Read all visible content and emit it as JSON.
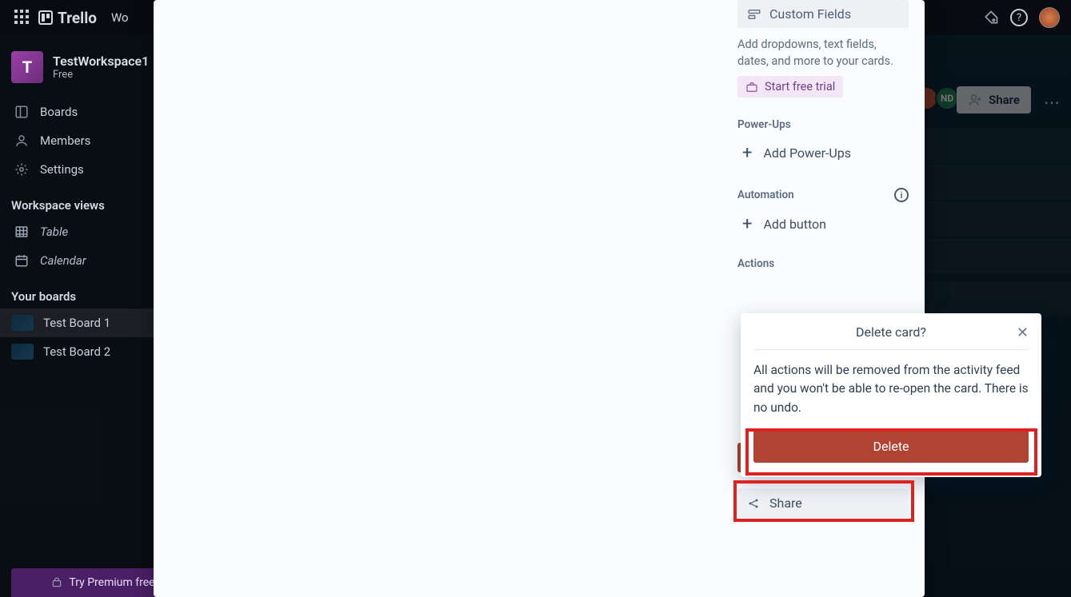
{
  "topnav": {
    "logo": "Trello",
    "workspaces_label": "Wo"
  },
  "workspace": {
    "initial": "T",
    "name": "TestWorkspace1",
    "plan": "Free"
  },
  "sidebar": {
    "boards": "Boards",
    "members": "Members",
    "settings": "Settings",
    "views_heading": "Workspace views",
    "table": "Table",
    "calendar": "Calendar",
    "your_boards_heading": "Your boards",
    "board1": "Test Board 1",
    "board2": "Test Board 2",
    "premium": "Try Premium free"
  },
  "board_header": {
    "member_initials": "ND",
    "share": "Share"
  },
  "card": {
    "custom_fields_label": "Custom Fields",
    "custom_fields_desc": "Add dropdowns, text fields, dates, and more to your cards.",
    "start_trial": "Start free trial",
    "powerups_heading": "Power-Ups",
    "add_powerups": "Add Power-Ups",
    "automation_heading": "Automation",
    "add_button": "Add button",
    "actions_heading": "Actions",
    "delete_label": "Delete",
    "share_label": "Share"
  },
  "popover": {
    "title": "Delete card?",
    "body": "All actions will be removed from the activity feed and you won't be able to re-open the card. There is no undo.",
    "delete_btn": "Delete"
  }
}
